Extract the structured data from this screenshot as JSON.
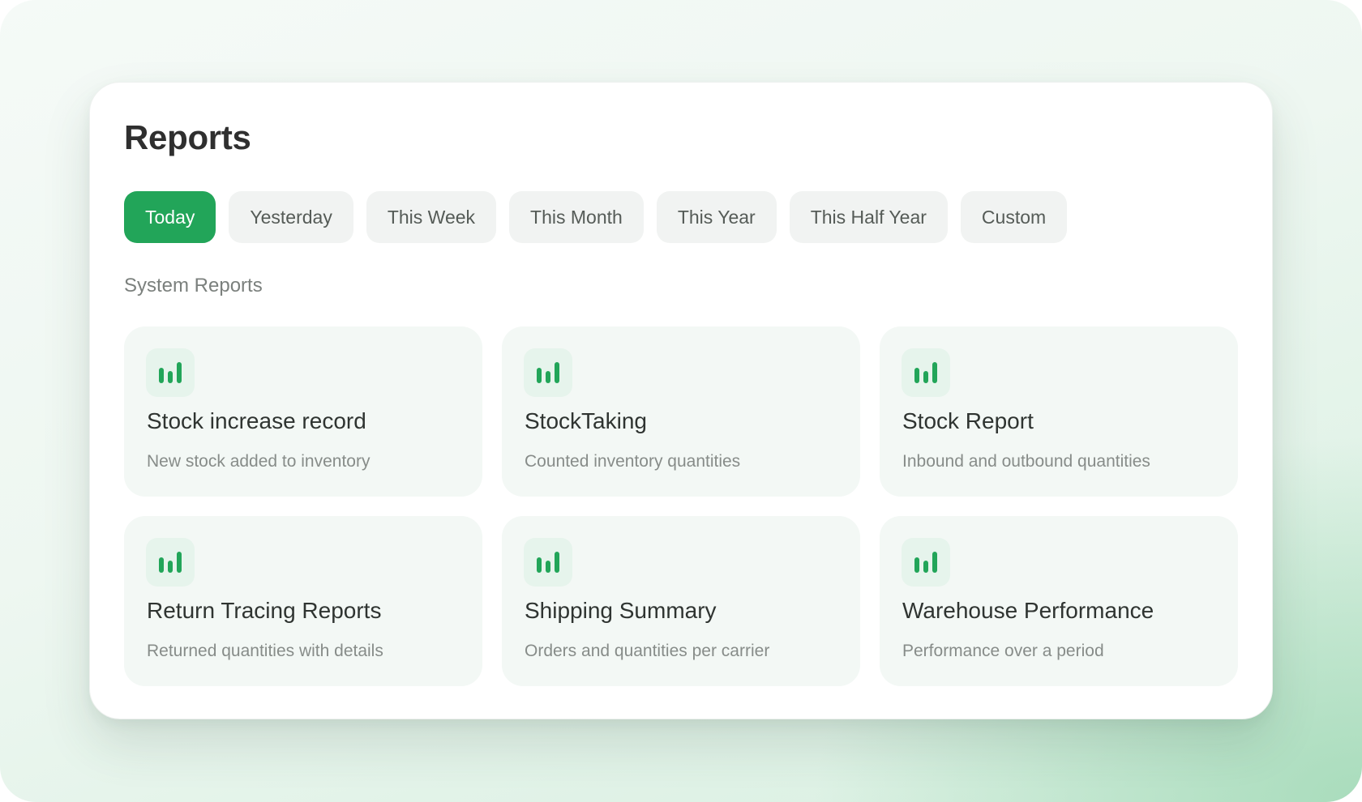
{
  "page": {
    "title": "Reports"
  },
  "filters": [
    {
      "label": "Today",
      "active": true
    },
    {
      "label": "Yesterday",
      "active": false
    },
    {
      "label": "This Week",
      "active": false
    },
    {
      "label": "This Month",
      "active": false
    },
    {
      "label": "This Year",
      "active": false
    },
    {
      "label": "This Half Year",
      "active": false
    },
    {
      "label": "Custom",
      "active": false
    }
  ],
  "section": {
    "title": "System Reports"
  },
  "reports": [
    {
      "icon": "bar-chart-icon",
      "title": "Stock increase record",
      "description": "New stock added to inventory"
    },
    {
      "icon": "bar-chart-icon",
      "title": "StockTaking",
      "description": "Counted inventory quantities"
    },
    {
      "icon": "bar-chart-icon",
      "title": "Stock Report",
      "description": "Inbound and outbound quantities"
    },
    {
      "icon": "bar-chart-icon",
      "title": "Return Tracing Reports",
      "description": "Returned quantities with details"
    },
    {
      "icon": "bar-chart-icon",
      "title": "Shipping Summary",
      "description": "Orders and quantities per carrier"
    },
    {
      "icon": "bar-chart-icon",
      "title": "Warehouse Performance",
      "description": "Performance over a period"
    }
  ],
  "colors": {
    "accent": "#22a559",
    "icon_bar": "#22a559",
    "card_bg": "#f3f8f5",
    "chip_bg": "#f1f3f2"
  }
}
